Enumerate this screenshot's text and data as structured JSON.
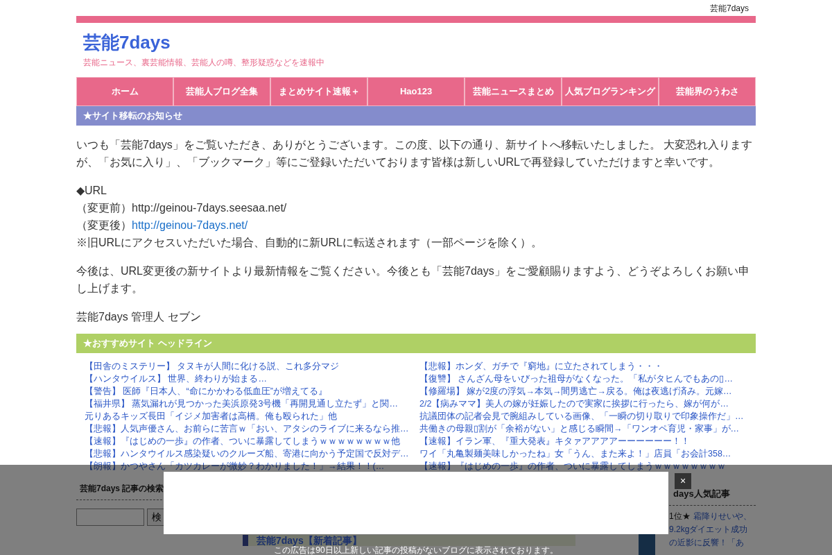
{
  "top_bar": {
    "site_name": "芸能7days"
  },
  "header": {
    "title": "芸能7days",
    "tagline": "芸能ニュース、裏芸能情報、芸能人の噂、整形疑惑などを速報中"
  },
  "nav": [
    {
      "label": "ホーム"
    },
    {
      "label": "芸能人ブログ全集"
    },
    {
      "label": "まとめサイト速報＋"
    },
    {
      "label": "Hao123"
    },
    {
      "label": "芸能ニュースまとめ"
    },
    {
      "label": "人気ブログランキング"
    },
    {
      "label": "芸能界のうわさ"
    }
  ],
  "notice": {
    "heading": "★サイト移転のお知らせ",
    "intro": "いつも「芸能7days」をご覧いただき、ありがとうございます。この度、以下の通り、新サイトへ移転いたしました。 大変恐れ入りますが、「お気に入り」、「ブックマーク」等にご登録いただいております皆様は新しいURLで再登録していただけますと幸いです。",
    "url_heading": "◆URL",
    "old_label": "（変更前）",
    "old_url": "http://geinou-7days.seesaa.net/",
    "new_label": "（変更後）",
    "new_url": "http://geinou-7days.net/",
    "redirect_note": "※旧URLにアクセスいただいた場合、自動的に新URLに転送されます（一部ページを除く）。",
    "closing": "今後は、URL変更後の新サイトより最新情報をご覧ください。今後とも「芸能7days」をご愛顧賜りますよう、どうぞよろしくお願い申し上げます。",
    "signature": "芸能7days 管理人 セブン"
  },
  "headlines": {
    "heading": "★おすすめサイト ヘッドライン",
    "columns": [
      [
        "【田舎のミステリー】 タヌキが人間に化ける説、これ多分マジ",
        "【ハンタウイルス】 世界、終わりが始まる…",
        "【警告】 医師『日本人、“命にかかわる低血圧”が増えてる』",
        "【福井県】 蒸気漏れが見つかった美浜原発3号機「再開見通し立たず」と関…",
        "元りあるキッズ長田「イジメ加害者は高橋。俺も殴られた」他",
        "【悲報】人気声優さん、お前らに苦言ｗ「おい、アタシのライブに来るなら推…",
        "【速報】『はじめの一歩』の作者、ついに暴露してしまうｗｗｗｗｗｗｗｗ他",
        "【悲報】ハンタウイルス感染疑いのクルーズ船、寄港に向かう予定国で反対デ…",
        "【朗報】かつやさん「カツカレーが微妙？わかりました！」→結果！！(…"
      ],
      [
        "【悲報】ホンダ、ガチで『窮地』に立たされてしまう・・・",
        "【復讐】 さんざん母をいびった祖母がなくなった。「私がタヒんでもあの▯…",
        "【修羅場】 嫁が2度の浮気→本気→間男逃亡→戻る。俺は夜逃げ済み。元嫁…",
        "2/2【病みママ】美人の嫁が妊娠したので実家に挨拶に行ったら、嫁が何が…",
        "抗議団体の記者会見で腕組みしている画像、「一瞬の切り取りで印象操作だ」…",
        "共働きの母親▯割が「余裕がない」と感じる瞬間→「ワンオペ育児・家事」が…",
        "【速報】イラン軍、『重大発表』キタァアアアアーーーーーー！！",
        "ワイ「丸亀製麺美味しかったね」女「うん、また来よ！」店員「お会計358…",
        "【速報】『はじめの一歩』の作者、ついに暴露してしまうｗｗｗｗｗｗｗｗ"
      ]
    ]
  },
  "search_widget": {
    "title": "芸能7days 記事の検索",
    "button": "検"
  },
  "banner": {
    "title": "芸能7days【新着記事】"
  },
  "ranking_widget": {
    "title": "days人気記事",
    "items": [
      {
        "rank": "1位★",
        "title": "霜降りせいや、9.2kgダイエット成功の近影に反響！「あ"
      }
    ]
  },
  "ad_overlay": {
    "close": "×",
    "notice": "この広告は90日以上新しい記事の投稿がないブログに表示されております。"
  }
}
